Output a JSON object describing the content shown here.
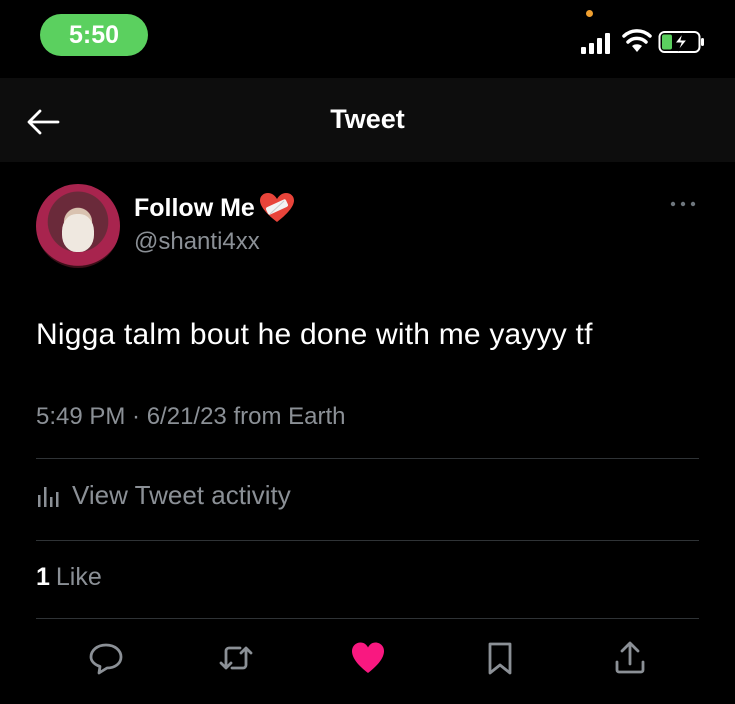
{
  "status_bar": {
    "time": "5:50"
  },
  "header": {
    "title": "Tweet"
  },
  "tweet": {
    "display_name": "Follow Me",
    "handle": "@shanti4xx",
    "text": "Nigga talm bout he done with me yayyy tf",
    "meta": "5:49 PM · 6/21/23 from Earth",
    "activity_label": "View Tweet activity",
    "like_count": "1",
    "like_label": "Like",
    "liked": true
  },
  "colors": {
    "background": "#000000",
    "header_background": "#0d0d0d",
    "secondary_text": "#8b9096",
    "like_pink": "#f91880",
    "time_pill": "#5bd05f"
  },
  "icons": [
    "back-arrow-icon",
    "signal-icon",
    "wifi-icon",
    "battery-charging-icon",
    "mending-heart-emoji-icon",
    "more-icon",
    "bar-chart-icon",
    "reply-icon",
    "retweet-icon",
    "heart-icon",
    "bookmark-icon",
    "share-icon"
  ]
}
